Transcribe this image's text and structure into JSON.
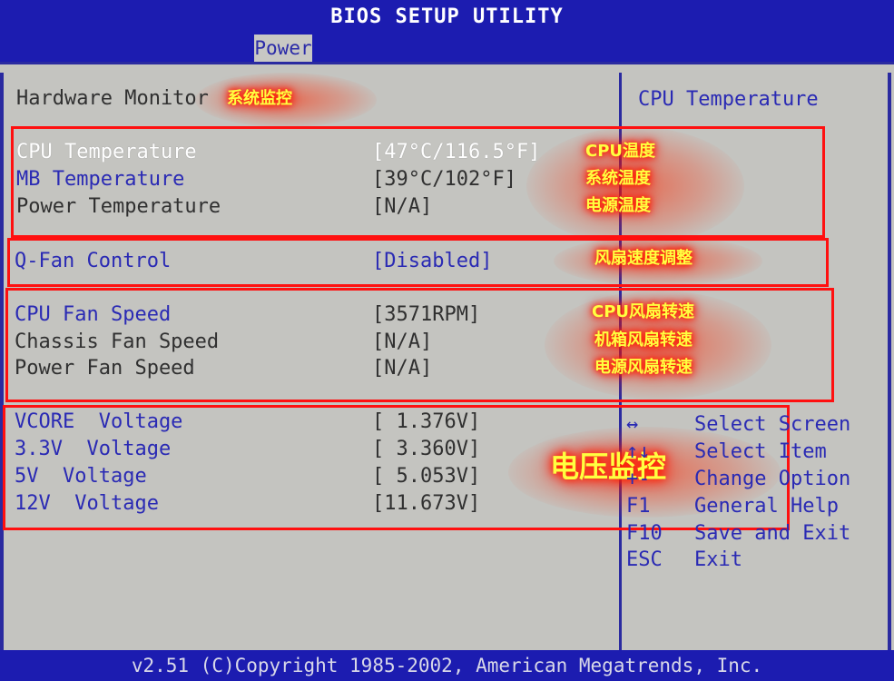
{
  "title": "BIOS SETUP UTILITY",
  "menu": {
    "active_tab": "Power"
  },
  "section": {
    "title": "Hardware Monitor",
    "annotation": "系统监控"
  },
  "rows": [
    {
      "label": "CPU Temperature",
      "value": "[47°C/116.5°F]",
      "annotation": "CPU温度",
      "style": "white"
    },
    {
      "label": "MB Temperature",
      "value": "[39°C/102°F]",
      "annotation": "系统温度",
      "style": "blue"
    },
    {
      "label": "Power Temperature",
      "value": "[N/A]",
      "annotation": "电源温度",
      "style": "dark"
    },
    {
      "label": "Q-Fan Control",
      "value": "[Disabled]",
      "annotation": "风扇速度调整",
      "style": "blue"
    },
    {
      "label": "CPU Fan Speed",
      "value": "[3571RPM]",
      "annotation": "CPU风扇转速",
      "style": "blue"
    },
    {
      "label": "Chassis Fan Speed",
      "value": "[N/A]",
      "annotation": "机箱风扇转速",
      "style": "dark"
    },
    {
      "label": "Power Fan Speed",
      "value": "[N/A]",
      "annotation": "电源风扇转速",
      "style": "dark"
    },
    {
      "label": "VCORE  Voltage",
      "value": "[ 1.376V]",
      "style": "blue"
    },
    {
      "label": "3.3V  Voltage",
      "value": "[ 3.360V]",
      "style": "blue"
    },
    {
      "label": "5V  Voltage",
      "value": "[ 5.053V]",
      "style": "blue"
    },
    {
      "label": "12V  Voltage",
      "value": "[11.673V]",
      "style": "blue"
    }
  ],
  "voltage_annotation": "电压监控",
  "help": {
    "title": "CPU Temperature",
    "keys": [
      {
        "key": "↔",
        "action": "Select Screen"
      },
      {
        "key": "↑↓",
        "action": "Select Item"
      },
      {
        "key": "+-",
        "action": "Change Option"
      },
      {
        "key": "F1",
        "action": "General Help"
      },
      {
        "key": "F10",
        "action": "Save and Exit"
      },
      {
        "key": "ESC",
        "action": "Exit"
      }
    ]
  },
  "footer": "v2.51 (C)Copyright 1985-2002, American Megatrends, Inc.",
  "colors": {
    "frame_blue": "#1c1cb0",
    "panel_gray": "#c4c4c0",
    "item_blue": "#2a2ab4",
    "highlight_white": "#ffffff",
    "annotation_red": "#ff1010",
    "annotation_yellow": "#ffff40"
  }
}
